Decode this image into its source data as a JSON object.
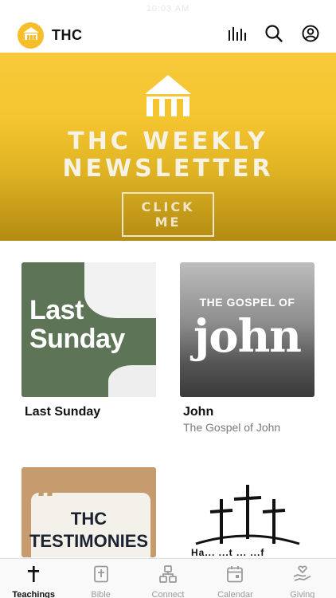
{
  "status_bar": {
    "time": "10:03 AM"
  },
  "header": {
    "title": "THC",
    "logo_icon": "house-icon"
  },
  "banner": {
    "title_line1": "THC WEEKLY",
    "title_line2": "NEWSLETTER",
    "cta_label": "CLICK ME",
    "background_color": "#f5c52f"
  },
  "cards": [
    {
      "title": "Last Sunday",
      "subtitle": "",
      "thumb_text_1": "Last",
      "thumb_text_2": "Sunday"
    },
    {
      "title": "John",
      "subtitle": "The Gospel of John",
      "thumb_text_1": "THE GOSPEL OF",
      "thumb_text_2": "john"
    },
    {
      "title": "",
      "subtitle": "",
      "thumb_text_1": "THC",
      "thumb_text_2": "TESTIMONIES"
    },
    {
      "title": "",
      "subtitle": "",
      "thumb_text_1": "Ha... ...t ... ...f"
    }
  ],
  "tabs": [
    {
      "label": "Teachings",
      "icon": "cross-icon",
      "active": true
    },
    {
      "label": "Bible",
      "icon": "bible-icon",
      "active": false
    },
    {
      "label": "Connect",
      "icon": "connect-icon",
      "active": false
    },
    {
      "label": "Calendar",
      "icon": "calendar-icon",
      "active": false
    },
    {
      "label": "Giving",
      "icon": "giving-icon",
      "active": false
    }
  ],
  "colors": {
    "accent": "#f6bf2a",
    "tab_inactive": "#9a9a9a",
    "tab_active": "#111111"
  }
}
